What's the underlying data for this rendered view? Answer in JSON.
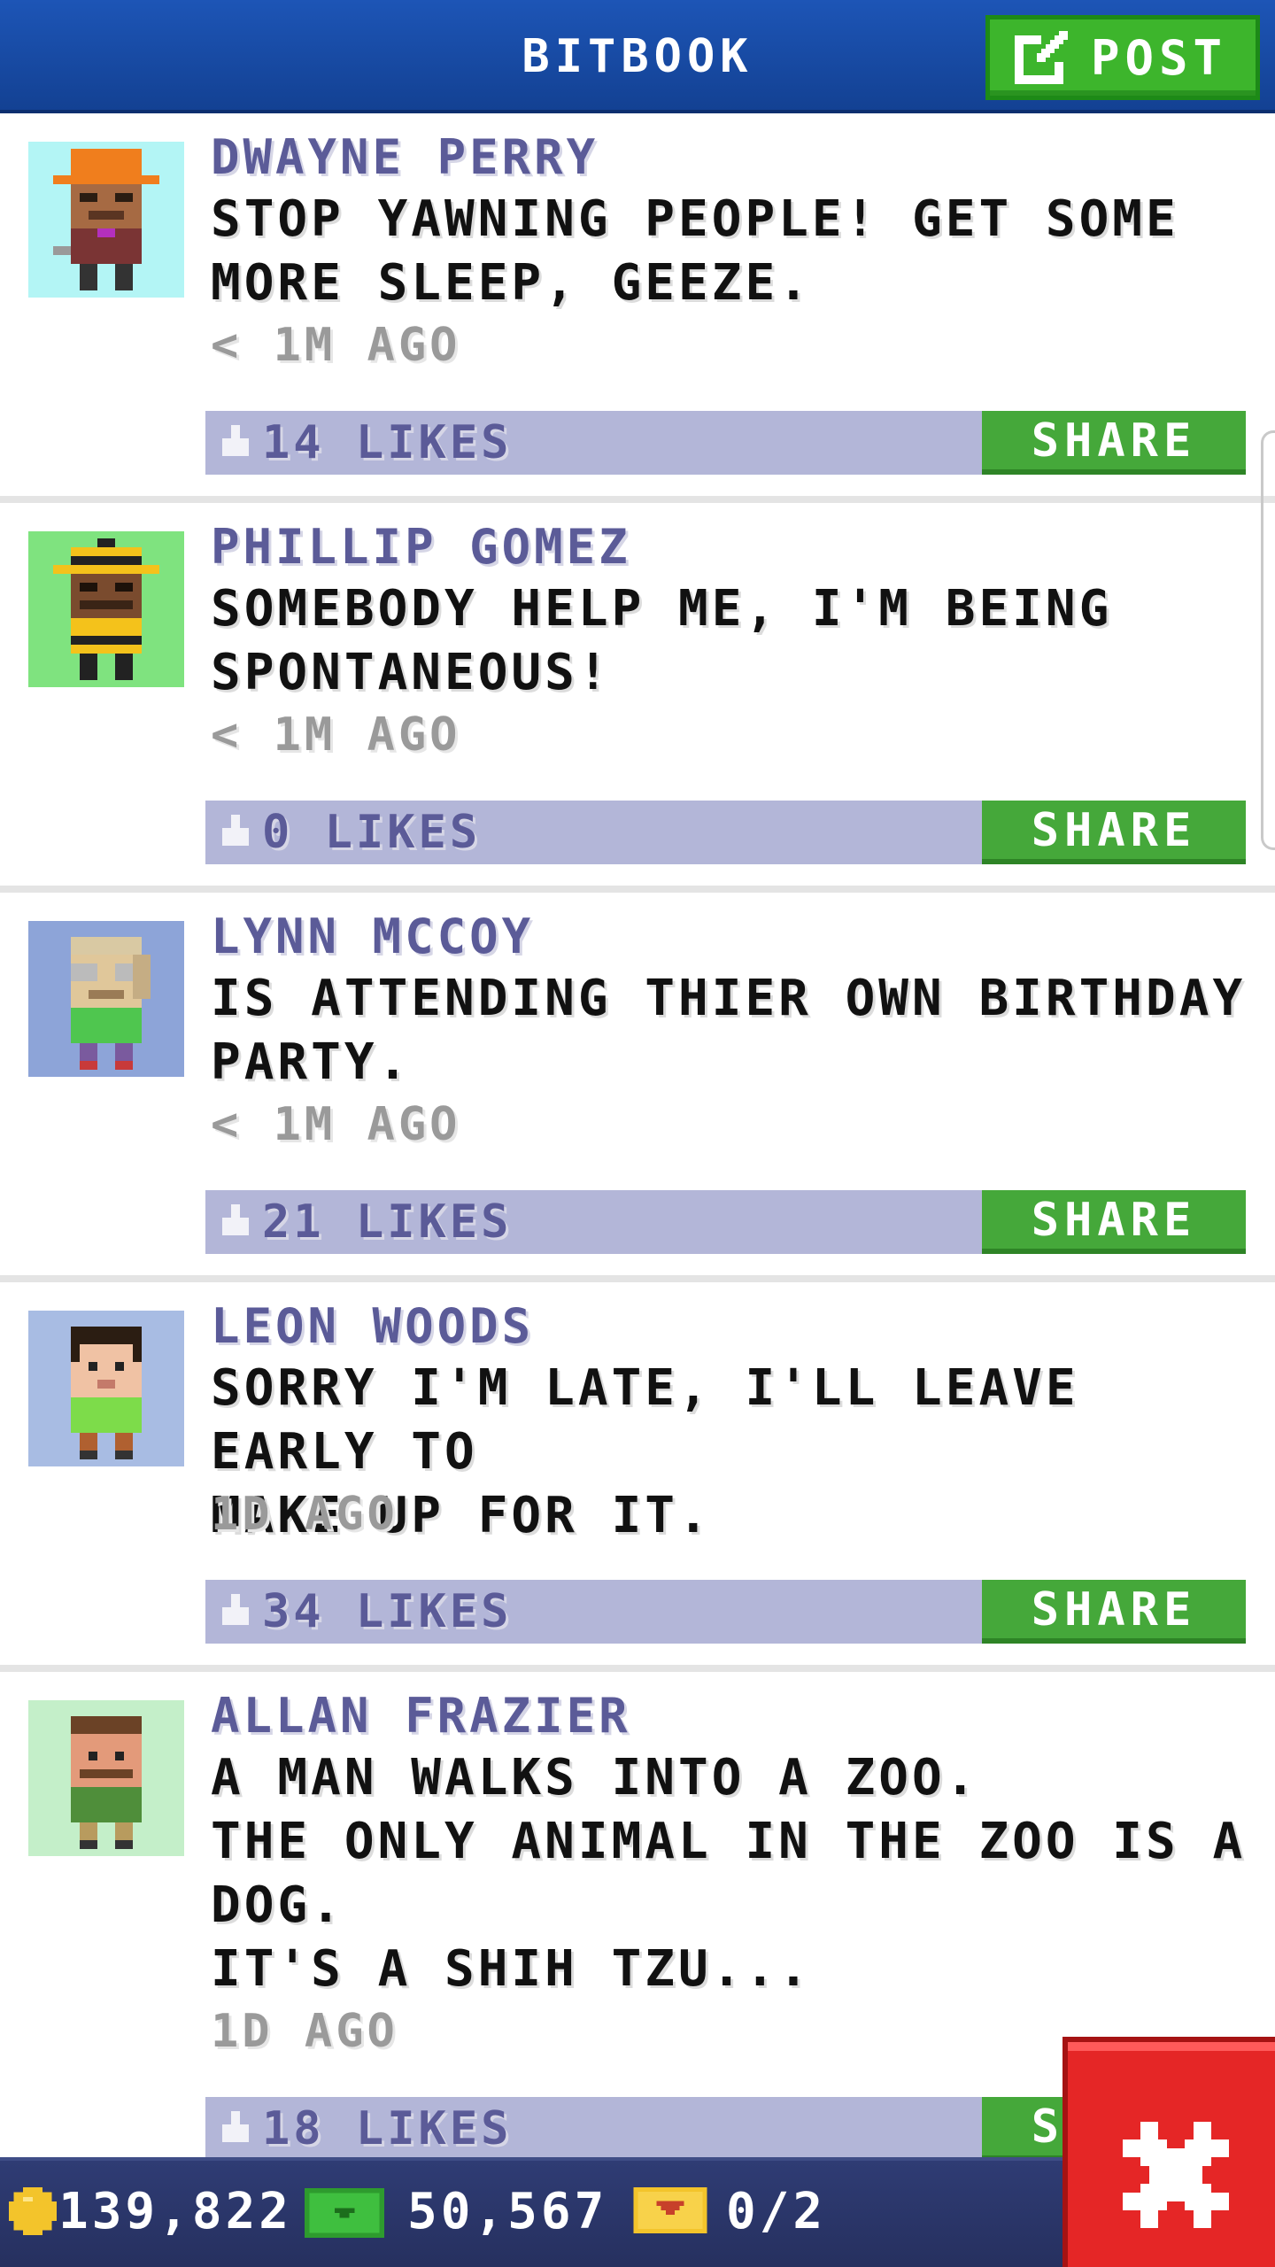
{
  "header": {
    "title": "BITBOOK",
    "post_label": "POST"
  },
  "posts": [
    {
      "name": "DWAYNE PERRY",
      "lines": [
        "STOP YAWNING PEOPLE! GET SOME",
        "MORE SLEEP, GEEZE."
      ],
      "time": "< 1M AGO",
      "likes": "14 LIKES",
      "share_label": "SHARE",
      "avatar_bg": "#b3f5f5",
      "avatar_icon": "construction-worker-avatar"
    },
    {
      "name": "PHILLIP GOMEZ",
      "lines": [
        "SOMEBODY HELP ME, I'M BEING",
        "SPONTANEOUS!"
      ],
      "time": "< 1M AGO",
      "likes": "0 LIKES",
      "share_label": "SHARE",
      "avatar_bg": "#7fe37f",
      "avatar_icon": "firefighter-avatar"
    },
    {
      "name": "LYNN MCCOY",
      "lines": [
        "IS ATTENDING THIER OWN BIRTHDAY",
        "PARTY."
      ],
      "time": "< 1M AGO",
      "likes": "21 LIKES",
      "share_label": "SHARE",
      "avatar_bg": "#8da4d8",
      "avatar_icon": "elder-glasses-avatar"
    },
    {
      "name": "LEON WOODS",
      "lines": [
        "SORRY I'M LATE, I'LL LEAVE EARLY TO",
        "MAKE UP FOR IT."
      ],
      "time": "1D AGO",
      "likes": "34 LIKES",
      "share_label": "SHARE",
      "avatar_bg": "#a8bce3",
      "avatar_icon": "young-man-avatar"
    },
    {
      "name": "ALLAN FRAZIER",
      "lines": [
        "A MAN WALKS INTO A ZOO.",
        "THE ONLY ANIMAL IN THE ZOO IS A",
        "DOG.",
        "IT'S A SHIH TZU..."
      ],
      "time": "1D AGO",
      "likes": "18 LIKES",
      "share_label": "SHARE",
      "avatar_bg": "#c4efc9",
      "avatar_icon": "mustache-man-avatar"
    }
  ],
  "bottom_bar": {
    "coins": "139,822",
    "bux": "50,567",
    "tickets": "0/2"
  },
  "colors": {
    "header_blue": "#1d55b6",
    "post_green": "#3db52c",
    "like_bar": "#b3b6d8",
    "name_purple": "#5b5b98",
    "close_red": "#e52626"
  }
}
